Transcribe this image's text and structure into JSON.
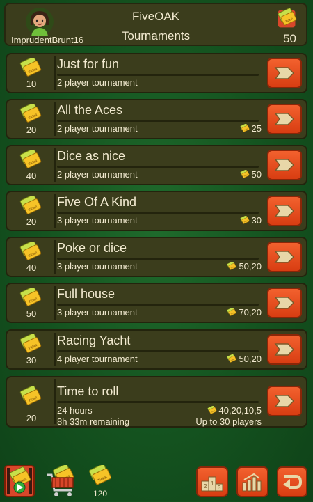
{
  "header": {
    "username": "ImprudentBrunt16",
    "title_line1": "FiveOAK",
    "title_line2": "Tournaments",
    "ticket_count": "50"
  },
  "ticket_label": "Ticket",
  "tournaments": [
    {
      "cost": "10",
      "name": "Just for fun",
      "desc": "2 player tournament",
      "prize": ""
    },
    {
      "cost": "20",
      "name": "All the Aces",
      "desc": "2 player tournament",
      "prize": "25"
    },
    {
      "cost": "40",
      "name": "Dice as nice",
      "desc": "2 player tournament",
      "prize": "50"
    },
    {
      "cost": "20",
      "name": "Five Of A Kind",
      "desc": "3 player tournament",
      "prize": "30"
    },
    {
      "cost": "40",
      "name": "Poke or dice",
      "desc": "3 player tournament",
      "prize": "50,20"
    },
    {
      "cost": "50",
      "name": "Full house",
      "desc": "3 player tournament",
      "prize": "70,20"
    },
    {
      "cost": "30",
      "name": "Racing Yacht",
      "desc": "4 player tournament",
      "prize": "50,20"
    },
    {
      "cost": "20",
      "name": "Time to roll",
      "line1": "24 hours",
      "line2": "8h 33m  remaining",
      "prize": "40,20,10,5",
      "players": "Up to 30 players"
    }
  ],
  "bottom_bar": {
    "ticket_count": "120",
    "icons": [
      "video-ticket-icon",
      "cart-icon",
      "ticket-icon",
      "leaderboard-icon",
      "stats-icon",
      "back-icon"
    ]
  },
  "colors": {
    "accent": "#e54b1c",
    "panel": "#3b3d1c",
    "background": "#14521f",
    "ticket": "#f0c326"
  }
}
